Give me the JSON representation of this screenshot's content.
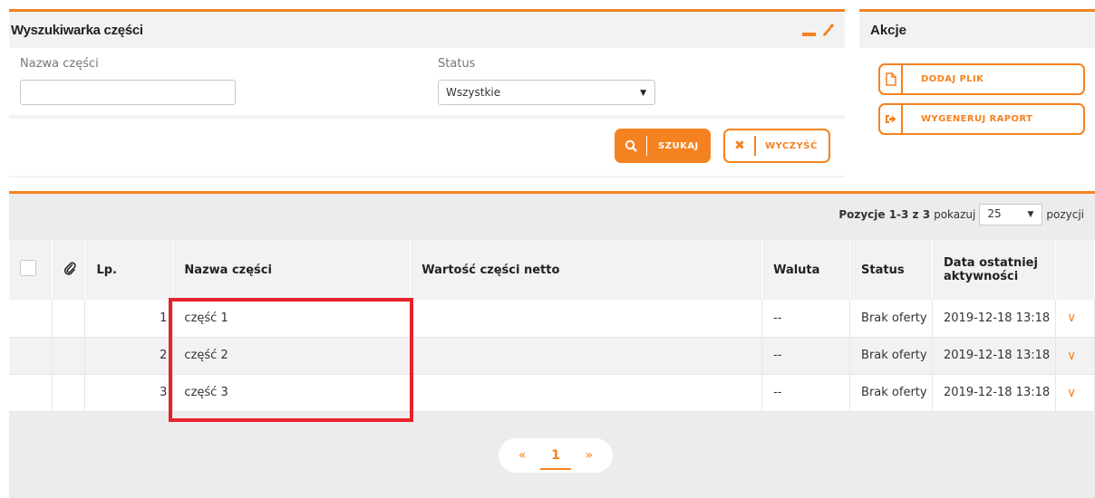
{
  "search": {
    "title": "Wyszukiwarka części",
    "name_label": "Nazwa części",
    "name_value": "",
    "status_label": "Status",
    "status_value": "Wszystkie",
    "search_button": "SZUKAJ",
    "clear_button": "WYCZYŚĆ"
  },
  "actions": {
    "title": "Akcje",
    "add_file": "DODAJ PLIK",
    "generate_report": "WYGENERUJ RAPORT"
  },
  "results": {
    "range": "Pozycje 1-3 z 3",
    "show_label": "pokazuj",
    "page_size": "25",
    "items_label": "pozycji",
    "columns": {
      "lp": "Lp.",
      "name": "Nazwa części",
      "value": "Wartość części netto",
      "currency": "Waluta",
      "status": "Status",
      "last_activity": "Data ostatniej aktywności"
    },
    "rows": [
      {
        "lp": "1",
        "name": "część 1",
        "value": "",
        "currency": "--",
        "status": "Brak oferty",
        "last_activity": "2019-12-18 13:18"
      },
      {
        "lp": "2",
        "name": "część 2",
        "value": "",
        "currency": "--",
        "status": "Brak oferty",
        "last_activity": "2019-12-18 13:18"
      },
      {
        "lp": "3",
        "name": "część 3",
        "value": "",
        "currency": "--",
        "status": "Brak oferty",
        "last_activity": "2019-12-18 13:18"
      }
    ]
  },
  "pagination": {
    "prev": "«",
    "current": "1",
    "next": "»"
  },
  "colors": {
    "accent": "#f58220",
    "highlight": "#e8222c"
  },
  "icons": [
    "minimize-icon",
    "wrench-icon",
    "search-icon",
    "close-icon",
    "file-icon",
    "export-icon",
    "paperclip-icon",
    "chevron-down-icon"
  ]
}
